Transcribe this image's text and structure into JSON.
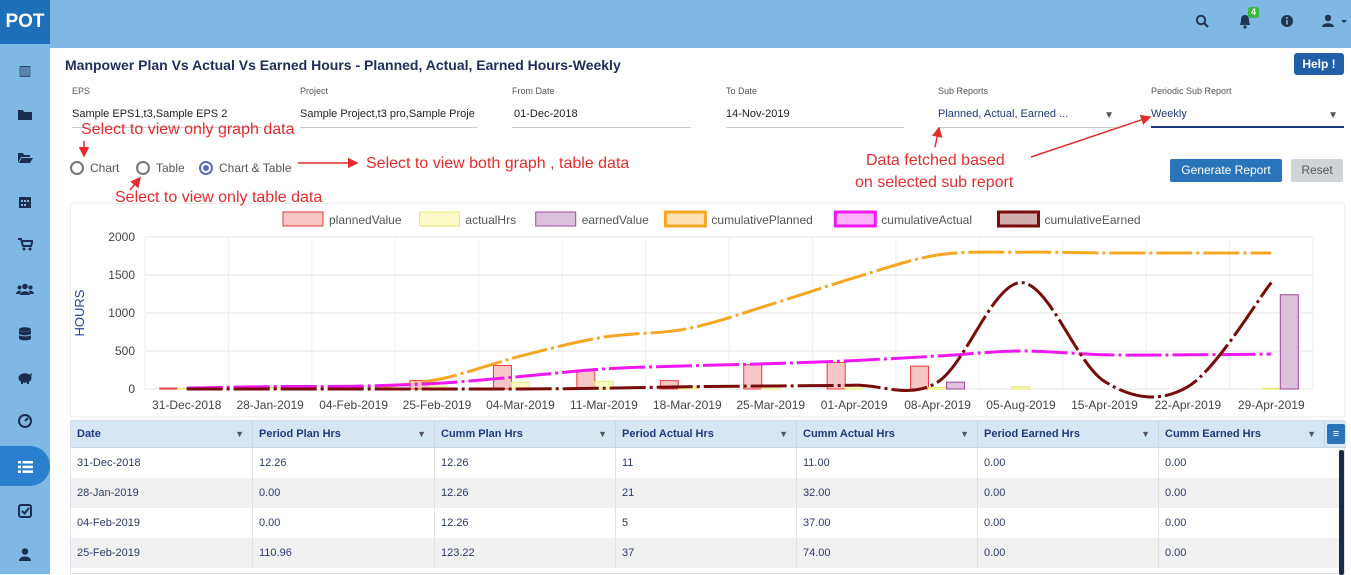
{
  "app": {
    "logo": "POT",
    "notification_count": "4"
  },
  "topbar": {
    "icons": [
      "search-icon",
      "bell-icon",
      "info-icon",
      "user-icon"
    ]
  },
  "sidebar": {
    "icons": [
      "building-icon",
      "folder-icon",
      "folder-open-icon",
      "calendar-icon",
      "cart-icon",
      "users-icon",
      "database-icon",
      "piggy-bank-icon",
      "dashboard-icon",
      "list-icon",
      "checklist-icon",
      "person-icon"
    ]
  },
  "page": {
    "title": "Manpower Plan Vs Actual Vs Earned Hours - Planned, Actual, Earned Hours-Weekly",
    "help_label": "Help !"
  },
  "filters": {
    "eps": {
      "label": "EPS",
      "value": "Sample EPS1,t3,Sample EPS 2"
    },
    "project": {
      "label": "Project",
      "value": "Sample Project,t3 pro,Sample Proje"
    },
    "from_date": {
      "label": "From Date",
      "value": "01-Dec-2018"
    },
    "to_date": {
      "label": "To Date",
      "value": "14-Nov-2019"
    },
    "sub_reports": {
      "label": "Sub Reports",
      "value": "Planned, Actual, Earned ..."
    },
    "periodic": {
      "label": "Periodic Sub Report",
      "value": "Weekly"
    }
  },
  "view_options": {
    "chart": "Chart",
    "table": "Table",
    "both": "Chart & Table",
    "selected": "both"
  },
  "buttons": {
    "generate": "Generate Report",
    "reset": "Reset"
  },
  "annotations": {
    "graph_only": "Select to view only graph data",
    "both": "Select to view both graph , table data",
    "table_only": "Select to view only table data",
    "sub_report_1": "Data fetched based",
    "sub_report_2": "on selected sub report"
  },
  "colors": {
    "accent": "#2a74bc",
    "annotation": "#e32d2d",
    "sidebar": "#7fb8e5"
  },
  "chart_data": {
    "type": "bar",
    "ylabel": "HOURS",
    "ylim": [
      0,
      2000
    ],
    "yticks": [
      "2000",
      "1500",
      "1000",
      "500",
      "0"
    ],
    "categories": [
      "31-Dec-2018",
      "28-Jan-2019",
      "04-Feb-2019",
      "25-Feb-2019",
      "04-Mar-2019",
      "11-Mar-2019",
      "18-Mar-2019",
      "25-Mar-2019",
      "01-Apr-2019",
      "08-Apr-2019",
      "05-Aug-2019",
      "15-Apr-2019",
      "22-Apr-2019",
      "29-Apr-2019"
    ],
    "legend_position": "top",
    "grid": true,
    "series": [
      {
        "name": "plannedValue",
        "kind": "bar",
        "color": "#e83a3a",
        "fill": "#f7c6c6",
        "values": [
          12,
          0,
          0,
          111,
          310,
          250,
          110,
          320,
          350,
          300,
          0,
          0,
          0,
          0
        ]
      },
      {
        "name": "actualHrs",
        "kind": "bar",
        "color": "#e8e870",
        "fill": "#fbfbc8",
        "values": [
          11,
          21,
          5,
          37,
          90,
          100,
          40,
          30,
          40,
          20,
          30,
          0,
          0,
          10
        ]
      },
      {
        "name": "earnedValue",
        "kind": "bar",
        "color": "#9b4a9b",
        "fill": "#dcc0dc",
        "values": [
          0,
          0,
          0,
          0,
          0,
          0,
          0,
          0,
          0,
          90,
          0,
          0,
          0,
          1240
        ]
      },
      {
        "name": "cumulativePlanned",
        "kind": "line",
        "color": "#f5a623",
        "values": [
          12,
          12,
          12,
          123,
          433,
          683,
          793,
          1113,
          1463,
          1763,
          1800,
          1790,
          1790,
          1790
        ]
      },
      {
        "name": "cumulativeActual",
        "kind": "line",
        "color": "#f018f0",
        "values": [
          11,
          32,
          37,
          74,
          164,
          264,
          304,
          334,
          374,
          434,
          500,
          450,
          450,
          460
        ]
      },
      {
        "name": "cumulativeEarned",
        "kind": "line",
        "color": "#7a0b0b",
        "values": [
          0,
          0,
          0,
          0,
          0,
          10,
          30,
          40,
          50,
          90,
          1400,
          100,
          30,
          1400
        ]
      }
    ]
  },
  "table": {
    "columns": [
      "Date",
      "Period Plan Hrs",
      "Cumm Plan Hrs",
      "Period Actual Hrs",
      "Cumm Actual Hrs",
      "Period Earned Hrs",
      "Cumm Earned Hrs"
    ],
    "rows": [
      [
        "31-Dec-2018",
        "12.26",
        "12.26",
        "11",
        "11.00",
        "0.00",
        "0.00"
      ],
      [
        "28-Jan-2019",
        "0.00",
        "12.26",
        "21",
        "32.00",
        "0.00",
        "0.00"
      ],
      [
        "04-Feb-2019",
        "0.00",
        "12.26",
        "5",
        "37.00",
        "0.00",
        "0.00"
      ],
      [
        "25-Feb-2019",
        "110.96",
        "123.22",
        "37",
        "74.00",
        "0.00",
        "0.00"
      ]
    ]
  }
}
